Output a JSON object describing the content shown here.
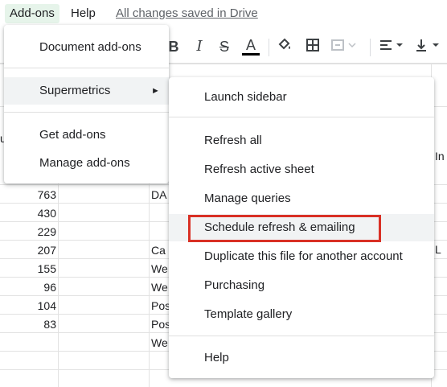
{
  "menubar": {
    "addons": "Add-ons",
    "help": "Help",
    "saved_status": "All changes saved in Drive"
  },
  "toolbar": {
    "bold": "B",
    "italic": "I",
    "strike": "S",
    "text_color": "A",
    "icons": [
      "fill-color-icon",
      "borders-icon",
      "merge-cells-icon",
      "align-left-icon",
      "valign-bottom-icon"
    ]
  },
  "grid": {
    "numbers": [
      "763",
      "430",
      "229",
      "207",
      "155",
      "96",
      "104",
      "83"
    ],
    "texts": [
      "DA",
      "",
      "",
      "Ca",
      "We",
      "We",
      "Pos",
      "Pos",
      "We"
    ],
    "right_edge": [
      "In",
      "L"
    ],
    "left_edge": "u"
  },
  "addons_menu": {
    "items": [
      {
        "label": "Document add-ons"
      },
      {
        "label": "Supermetrics",
        "has_submenu": true
      },
      {
        "label": "Get add-ons"
      },
      {
        "label": "Manage add-ons"
      }
    ],
    "submenu_arrow": "►"
  },
  "supermetrics_menu": {
    "items": [
      {
        "label": "Launch sidebar"
      },
      {
        "label": "Refresh all"
      },
      {
        "label": "Refresh active sheet"
      },
      {
        "label": "Manage queries"
      },
      {
        "label": "Schedule refresh & emailing",
        "highlighted": true
      },
      {
        "label": "Duplicate this file for another account"
      },
      {
        "label": "Purchasing"
      },
      {
        "label": "Template gallery"
      },
      {
        "label": "Help"
      }
    ]
  },
  "colors": {
    "highlight_box": "#d93025",
    "menu_active_bg": "#e6f4ea"
  }
}
